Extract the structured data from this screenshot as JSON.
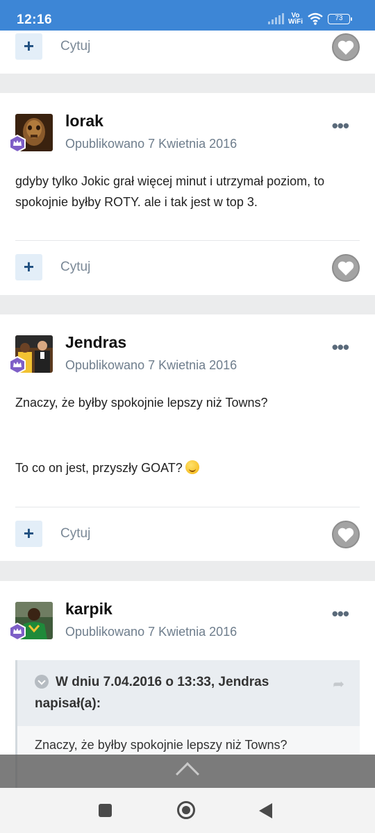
{
  "status_bar": {
    "time": "12:16",
    "network_label_1": "Vo",
    "network_label_2": "WiFi",
    "battery": "73"
  },
  "actions": {
    "quote_label": "Cytuj",
    "plus_label": "+"
  },
  "posts": [
    {
      "author": "lorak",
      "date": "Opublikowano 7 Kwietnia 2016",
      "text": "gdyby tylko Jokic grał więcej minut i utrzymał poziom, to spokojnie byłby ROTY. ale i tak jest w top 3."
    },
    {
      "author": "Jendras",
      "date": "Opublikowano 7 Kwietnia 2016",
      "text_line_1": "Znaczy, że byłby spokojnie lepszy niż Towns?",
      "text_line_2": "To co on jest, przyszły GOAT?"
    },
    {
      "author": "karpik",
      "date": "Opublikowano 7 Kwietnia 2016",
      "quote": {
        "citation": "W dniu 7.04.2016 o 13:33, Jendras napisał(a):",
        "body": "Znaczy, że byłby spokojnie lepszy niż Towns?"
      }
    }
  ],
  "more_icon": "ellipsis-icon",
  "colors": {
    "status_bar": "#3d86d6",
    "accent": "#1f4f80",
    "muted_text": "#6e7d8c",
    "rank_badge": "#7e5fc7"
  }
}
